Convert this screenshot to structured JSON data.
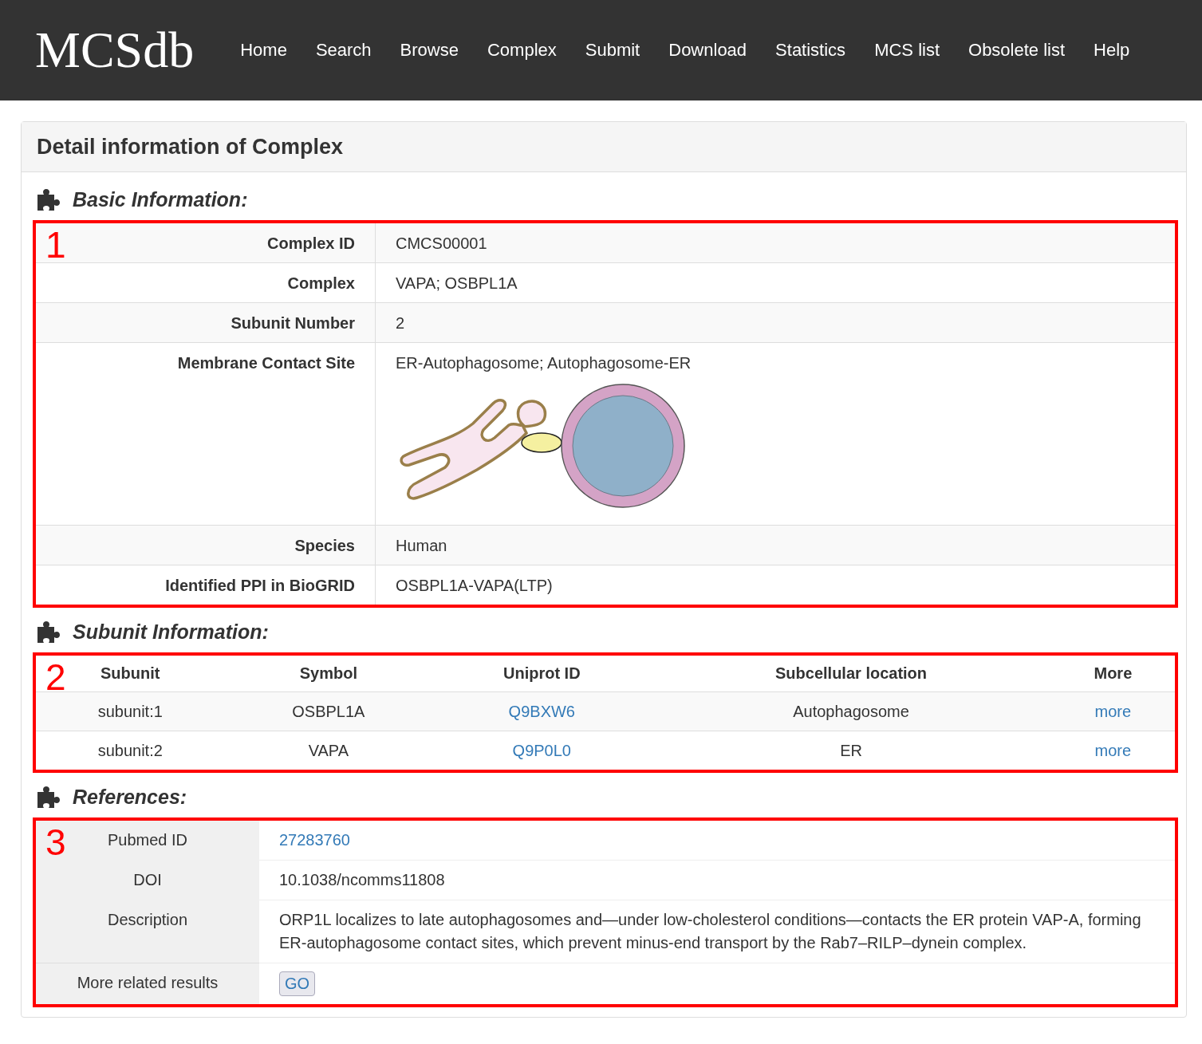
{
  "brand": "MCSdb",
  "nav": [
    {
      "label": "Home"
    },
    {
      "label": "Search"
    },
    {
      "label": "Browse"
    },
    {
      "label": "Complex"
    },
    {
      "label": "Submit"
    },
    {
      "label": "Download"
    },
    {
      "label": "Statistics"
    },
    {
      "label": "MCS list"
    },
    {
      "label": "Obsolete list"
    },
    {
      "label": "Help"
    }
  ],
  "panel_title": "Detail information of Complex",
  "basic": {
    "heading": "Basic Information:",
    "annotation": "1",
    "rows": [
      {
        "kind": "text",
        "label": "Complex ID",
        "value": "CMCS00001"
      },
      {
        "kind": "text",
        "label": "Complex",
        "value": "VAPA; OSBPL1A"
      },
      {
        "kind": "text",
        "label": "Subunit Number",
        "value": "2"
      },
      {
        "kind": "diagram",
        "label": "Membrane Contact Site",
        "value": "ER-Autophagosome; Autophagosome-ER"
      },
      {
        "kind": "text",
        "label": "Species",
        "value": "Human"
      },
      {
        "kind": "text",
        "label": "Identified PPI in BioGRID",
        "value": "OSBPL1A-VAPA(LTP)"
      }
    ]
  },
  "subunits": {
    "heading": "Subunit Information:",
    "annotation": "2",
    "columns": [
      "Subunit",
      "Symbol",
      "Uniprot ID",
      "Subcellular location",
      "More"
    ],
    "rows": [
      [
        {
          "text": "subunit:1",
          "link": false
        },
        {
          "text": "OSBPL1A",
          "link": false
        },
        {
          "text": "Q9BXW6",
          "link": true
        },
        {
          "text": "Autophagosome",
          "link": false
        },
        {
          "text": "more",
          "link": true
        }
      ],
      [
        {
          "text": "subunit:2",
          "link": false
        },
        {
          "text": "VAPA",
          "link": false
        },
        {
          "text": "Q9P0L0",
          "link": true
        },
        {
          "text": "ER",
          "link": false
        },
        {
          "text": "more",
          "link": true
        }
      ]
    ]
  },
  "references": {
    "heading": "References:",
    "annotation": "3",
    "rows": [
      {
        "kind": "link",
        "label": "Pubmed ID",
        "value": "27283760"
      },
      {
        "kind": "text",
        "label": "DOI",
        "value": "10.1038/ncomms11808"
      },
      {
        "kind": "text",
        "label": "Description",
        "value": "ORP1L localizes to late autophagosomes and—under low-cholesterol conditions—contacts the ER protein VAP-A, forming ER-autophagosome contact sites, which prevent minus-end transport by the Rab7–RILP–dynein complex."
      },
      {
        "kind": "button",
        "label": "More related results",
        "value": "GO"
      }
    ]
  }
}
